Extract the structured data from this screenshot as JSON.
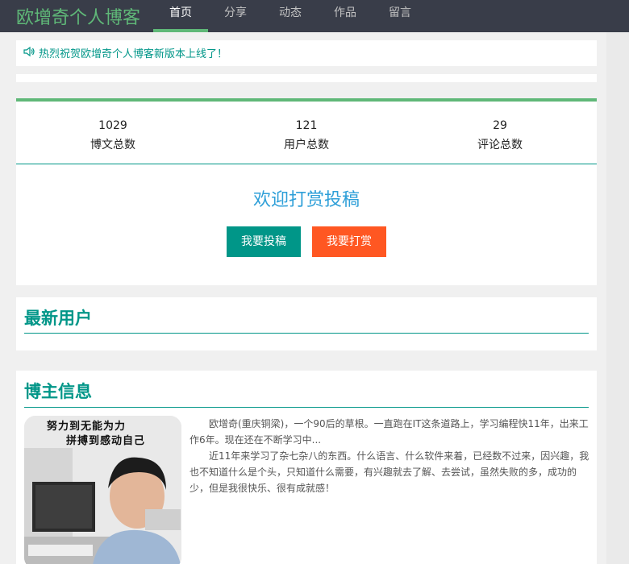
{
  "header": {
    "logo_text": "欧增奇个人博客",
    "nav": [
      {
        "label": "首页",
        "active": true
      },
      {
        "label": "分享",
        "active": false
      },
      {
        "label": "动态",
        "active": false
      },
      {
        "label": "作品",
        "active": false
      },
      {
        "label": "留言",
        "active": false
      }
    ]
  },
  "notice": {
    "icon": "speaker-icon",
    "text": "热烈祝贺欧增奇个人博客新版本上线了！"
  },
  "stats": {
    "items": [
      {
        "value": "1029",
        "label": "博文总数"
      },
      {
        "value": "121",
        "label": "用户总数"
      },
      {
        "value": "29",
        "label": "评论总数"
      }
    ],
    "welcome": "欢迎打赏投稿",
    "submit_label": "我要投稿",
    "donate_label": "我要打赏"
  },
  "latest_users": {
    "title": "最新用户"
  },
  "blogger": {
    "title": "博主信息",
    "avatar_motto_line1": "努力到无能为力",
    "avatar_motto_line2": "拼搏到感动自己",
    "bio_p1": "欧增奇(重庆铜梁)，一个90后的草根。一直跑在IT这条道路上，学习编程快11年，出来工作6年。现在还在不断学习中...",
    "bio_p2": "近11年来学习了杂七杂八的东西。什么语言、什么软件来着，已经数不过来，因兴趣，我也不知道什么是个头，只知道什么需要，有兴趣就去了解、去尝试，虽然失败的多，成功的少，但是我很快乐、很有成就感！"
  },
  "colors": {
    "nav_bg": "#393d49",
    "accent_green": "#5fb878",
    "teal": "#009688",
    "orange": "#ff5722",
    "welcome_blue": "#2e9fd8"
  }
}
